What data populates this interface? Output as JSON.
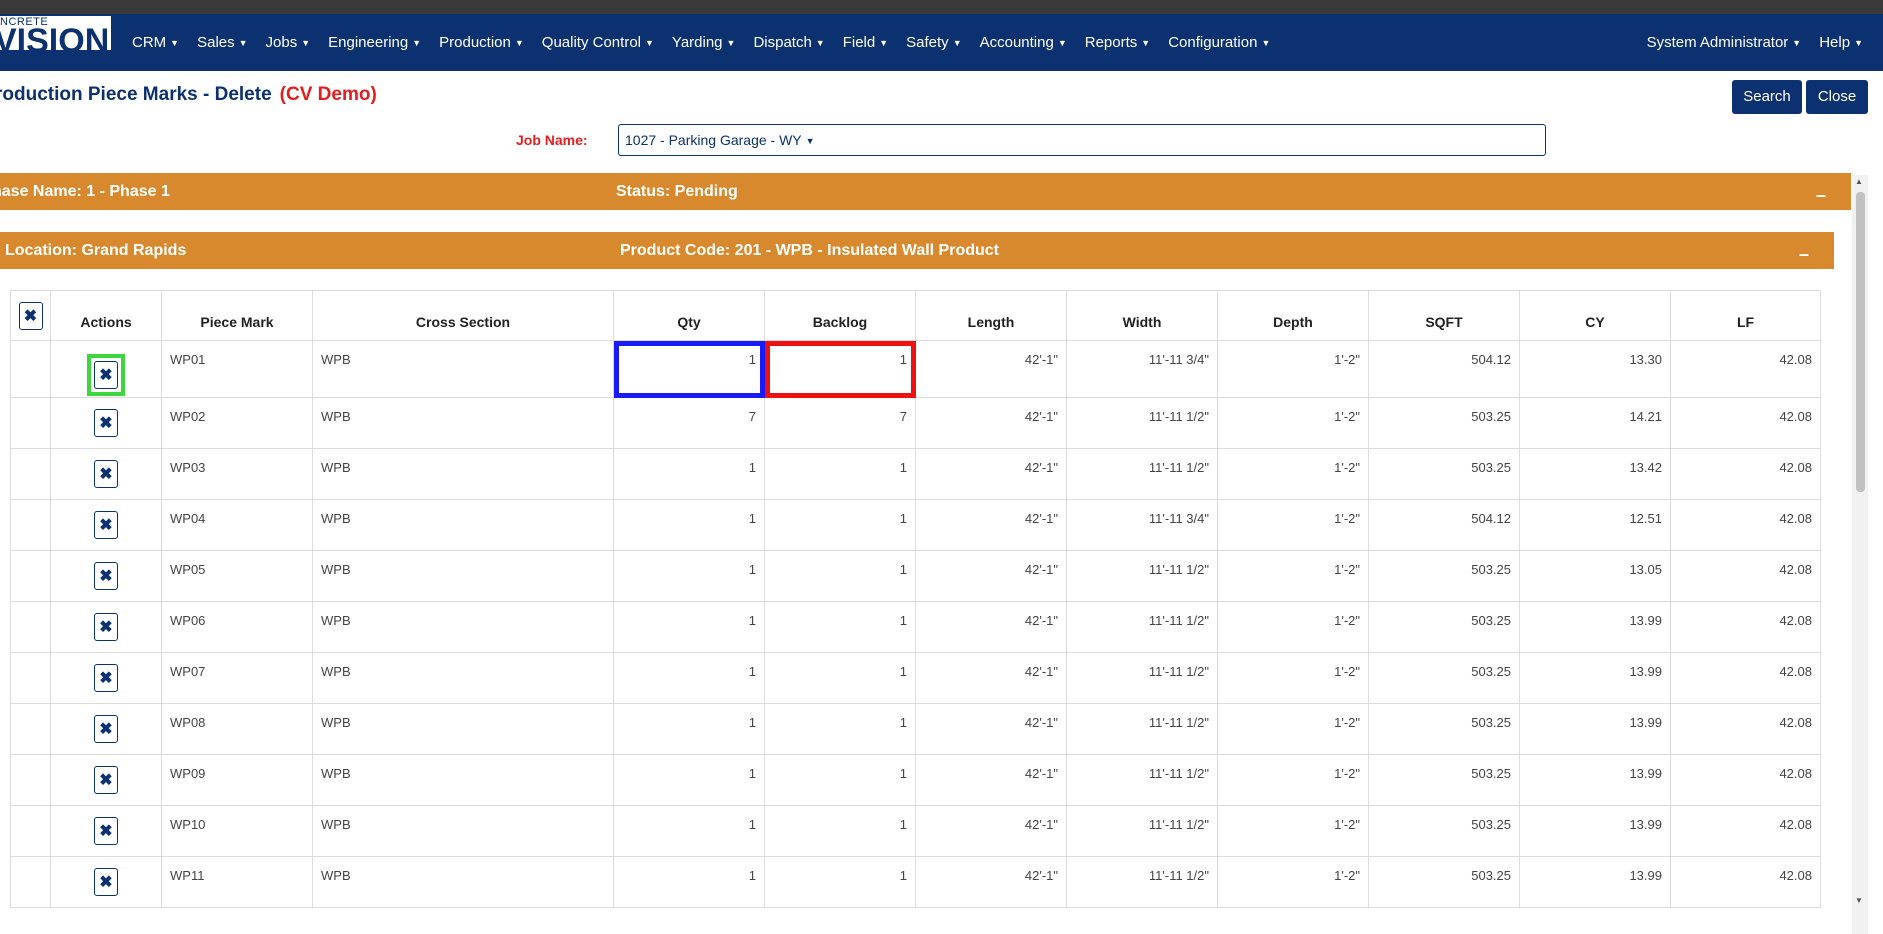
{
  "app": {
    "logo_small": "NCRETE",
    "logo_big": "VISION"
  },
  "nav": {
    "items": [
      "CRM",
      "Sales",
      "Jobs",
      "Engineering",
      "Production",
      "Quality Control",
      "Yarding",
      "Dispatch",
      "Field",
      "Safety",
      "Accounting",
      "Reports",
      "Configuration"
    ],
    "user": "System Administrator",
    "help": "Help"
  },
  "page": {
    "title": "roduction Piece Marks - Delete",
    "demo_tag": "(CV Demo)",
    "search_label": "Search",
    "close_label": "Close"
  },
  "filter": {
    "job_label": "Job Name:",
    "job_value": "1027 - Parking Garage - WY"
  },
  "phase_bar": {
    "left": "hase Name: 1 - Phase 1",
    "status": "Status: Pending",
    "collapse": "–"
  },
  "location_bar": {
    "left": "Location: Grand Rapids",
    "product": "Product Code: 201 - WPB - Insulated Wall Product",
    "collapse": "–"
  },
  "table": {
    "headers": [
      "",
      "Actions",
      "Piece Mark",
      "Cross Section",
      "Qty",
      "Backlog",
      "Length",
      "Width",
      "Depth",
      "SQFT",
      "CY",
      "LF"
    ],
    "delete_glyph": "✖",
    "rows": [
      {
        "mark": "WP01",
        "cross": "WPB",
        "qty": "1",
        "backlog": "1",
        "length": "42'-1\"",
        "width": "11'-11 3/4\"",
        "depth": "1'-2\"",
        "sqft": "504.12",
        "cy": "13.30",
        "lf": "42.08"
      },
      {
        "mark": "WP02",
        "cross": "WPB",
        "qty": "7",
        "backlog": "7",
        "length": "42'-1\"",
        "width": "11'-11 1/2\"",
        "depth": "1'-2\"",
        "sqft": "503.25",
        "cy": "14.21",
        "lf": "42.08"
      },
      {
        "mark": "WP03",
        "cross": "WPB",
        "qty": "1",
        "backlog": "1",
        "length": "42'-1\"",
        "width": "11'-11 1/2\"",
        "depth": "1'-2\"",
        "sqft": "503.25",
        "cy": "13.42",
        "lf": "42.08"
      },
      {
        "mark": "WP04",
        "cross": "WPB",
        "qty": "1",
        "backlog": "1",
        "length": "42'-1\"",
        "width": "11'-11 3/4\"",
        "depth": "1'-2\"",
        "sqft": "504.12",
        "cy": "12.51",
        "lf": "42.08"
      },
      {
        "mark": "WP05",
        "cross": "WPB",
        "qty": "1",
        "backlog": "1",
        "length": "42'-1\"",
        "width": "11'-11 1/2\"",
        "depth": "1'-2\"",
        "sqft": "503.25",
        "cy": "13.05",
        "lf": "42.08"
      },
      {
        "mark": "WP06",
        "cross": "WPB",
        "qty": "1",
        "backlog": "1",
        "length": "42'-1\"",
        "width": "11'-11 1/2\"",
        "depth": "1'-2\"",
        "sqft": "503.25",
        "cy": "13.99",
        "lf": "42.08"
      },
      {
        "mark": "WP07",
        "cross": "WPB",
        "qty": "1",
        "backlog": "1",
        "length": "42'-1\"",
        "width": "11'-11 1/2\"",
        "depth": "1'-2\"",
        "sqft": "503.25",
        "cy": "13.99",
        "lf": "42.08"
      },
      {
        "mark": "WP08",
        "cross": "WPB",
        "qty": "1",
        "backlog": "1",
        "length": "42'-1\"",
        "width": "11'-11 1/2\"",
        "depth": "1'-2\"",
        "sqft": "503.25",
        "cy": "13.99",
        "lf": "42.08"
      },
      {
        "mark": "WP09",
        "cross": "WPB",
        "qty": "1",
        "backlog": "1",
        "length": "42'-1\"",
        "width": "11'-11 1/2\"",
        "depth": "1'-2\"",
        "sqft": "503.25",
        "cy": "13.99",
        "lf": "42.08"
      },
      {
        "mark": "WP10",
        "cross": "WPB",
        "qty": "1",
        "backlog": "1",
        "length": "42'-1\"",
        "width": "11'-11 1/2\"",
        "depth": "1'-2\"",
        "sqft": "503.25",
        "cy": "13.99",
        "lf": "42.08"
      },
      {
        "mark": "WP11",
        "cross": "WPB",
        "qty": "1",
        "backlog": "1",
        "length": "42'-1\"",
        "width": "11'-11 1/2\"",
        "depth": "1'-2\"",
        "sqft": "503.25",
        "cy": "13.99",
        "lf": "42.08"
      }
    ]
  },
  "colors": {
    "navy": "#0b3170",
    "orange": "#d8892d",
    "demo_red": "#e41e1e",
    "highlight_green": "#3ed63e",
    "highlight_blue": "#1a1aff",
    "highlight_red": "#ee1111"
  }
}
